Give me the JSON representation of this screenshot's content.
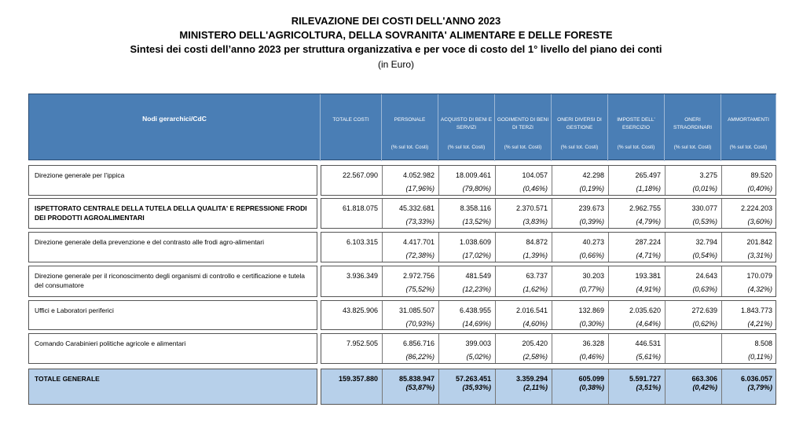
{
  "titles": {
    "line1": "RILEVAZIONE DEI COSTI DELL'ANNO 2023",
    "line2": "MINISTERO DELL'AGRICOLTURA, DELLA SOVRANITA' ALIMENTARE E DELLE FORESTE",
    "line3": "Sintesi dei costi dell’anno 2023 per struttura organizzativa e per voce di costo del 1° livello del piano dei conti",
    "unit": "(in Euro)"
  },
  "header": {
    "nodes": "Nodi gerarchici/CdC",
    "columns": [
      {
        "label": "TOTALE COSTI",
        "pct": ""
      },
      {
        "label": "PERSONALE",
        "pct": "(% sul tot. Costi)"
      },
      {
        "label": "ACQUISTO DI BENI E SERVIZI",
        "pct": "(% sul tot. Costi)"
      },
      {
        "label": "GODIMENTO DI BENI DI TERZI",
        "pct": "(% sul tot. Costi)"
      },
      {
        "label": "ONERI DIVERSI DI GESTIONE",
        "pct": "(% sul tot. Costi)"
      },
      {
        "label": "IMPOSTE DELL' ESERCIZIO",
        "pct": "(% sul tot. Costi)"
      },
      {
        "label": "ONERI STRAORDINARI",
        "pct": "(% sul tot. Costi)"
      },
      {
        "label": "AMMORTAMENTI",
        "pct": "(% sul tot. Costi)"
      }
    ]
  },
  "rows": [
    {
      "name": "Direzione generale per l’ippica",
      "values": [
        "22.567.090",
        "4.052.982",
        "18.009.461",
        "104.057",
        "42.298",
        "265.497",
        "3.275",
        "89.520"
      ],
      "pcts": [
        "",
        "(17,96%)",
        "(79,80%)",
        "(0,46%)",
        "(0,19%)",
        "(1,18%)",
        "(0,01%)",
        "(0,40%)"
      ]
    },
    {
      "name": "ISPETTORATO CENTRALE DELLA TUTELA DELLA QUALITA' E REPRESSIONE FRODI DEI PRODOTTI AGROALIMENTARI",
      "values": [
        "61.818.075",
        "45.332.681",
        "8.358.116",
        "2.370.571",
        "239.673",
        "2.962.755",
        "330.077",
        "2.224.203"
      ],
      "pcts": [
        "",
        "(73,33%)",
        "(13,52%)",
        "(3,83%)",
        "(0,39%)",
        "(4,79%)",
        "(0,53%)",
        "(3,60%)"
      ]
    },
    {
      "name": "Direzione generale della prevenzione e del contrasto alle frodi agro-alimentari",
      "values": [
        "6.103.315",
        "4.417.701",
        "1.038.609",
        "84.872",
        "40.273",
        "287.224",
        "32.794",
        "201.842"
      ],
      "pcts": [
        "",
        "(72,38%)",
        "(17,02%)",
        "(1,39%)",
        "(0,66%)",
        "(4,71%)",
        "(0,54%)",
        "(3,31%)"
      ]
    },
    {
      "name": "Direzione generale per il riconoscimento degli organismi di controllo e certificazione e tutela del consumatore",
      "values": [
        "3.936.349",
        "2.972.756",
        "481.549",
        "63.737",
        "30.203",
        "193.381",
        "24.643",
        "170.079"
      ],
      "pcts": [
        "",
        "(75,52%)",
        "(12,23%)",
        "(1,62%)",
        "(0,77%)",
        "(4,91%)",
        "(0,63%)",
        "(4,32%)"
      ]
    },
    {
      "name": "Uffici e Laboratori periferici",
      "values": [
        "43.825.906",
        "31.085.507",
        "6.438.955",
        "2.016.541",
        "132.869",
        "2.035.620",
        "272.639",
        "1.843.773"
      ],
      "pcts": [
        "",
        "(70,93%)",
        "(14,69%)",
        "(4,60%)",
        "(0,30%)",
        "(4,64%)",
        "(0,62%)",
        "(4,21%)"
      ]
    },
    {
      "name": "Comando Carabinieri politiche agricole e alimentari",
      "values": [
        "7.952.505",
        "6.856.716",
        "399.003",
        "205.420",
        "36.328",
        "446.531",
        "",
        "8.508"
      ],
      "pcts": [
        "",
        "(86,22%)",
        "(5,02%)",
        "(2,58%)",
        "(0,46%)",
        "(5,61%)",
        "",
        "(0,11%)"
      ]
    }
  ],
  "total": {
    "name": "TOTALE GENERALE",
    "values": [
      "159.357.880",
      "85.838.947",
      "57.263.451",
      "3.359.294",
      "605.099",
      "5.591.727",
      "663.306",
      "6.036.057"
    ],
    "pcts": [
      "",
      "(53,87%)",
      "(35,93%)",
      "(2,11%)",
      "(0,38%)",
      "(3,51%)",
      "(0,42%)",
      "(3,79%)"
    ]
  },
  "colors": {
    "header_fill": "#4a7eb5",
    "total_fill": "#b7d0ea"
  }
}
